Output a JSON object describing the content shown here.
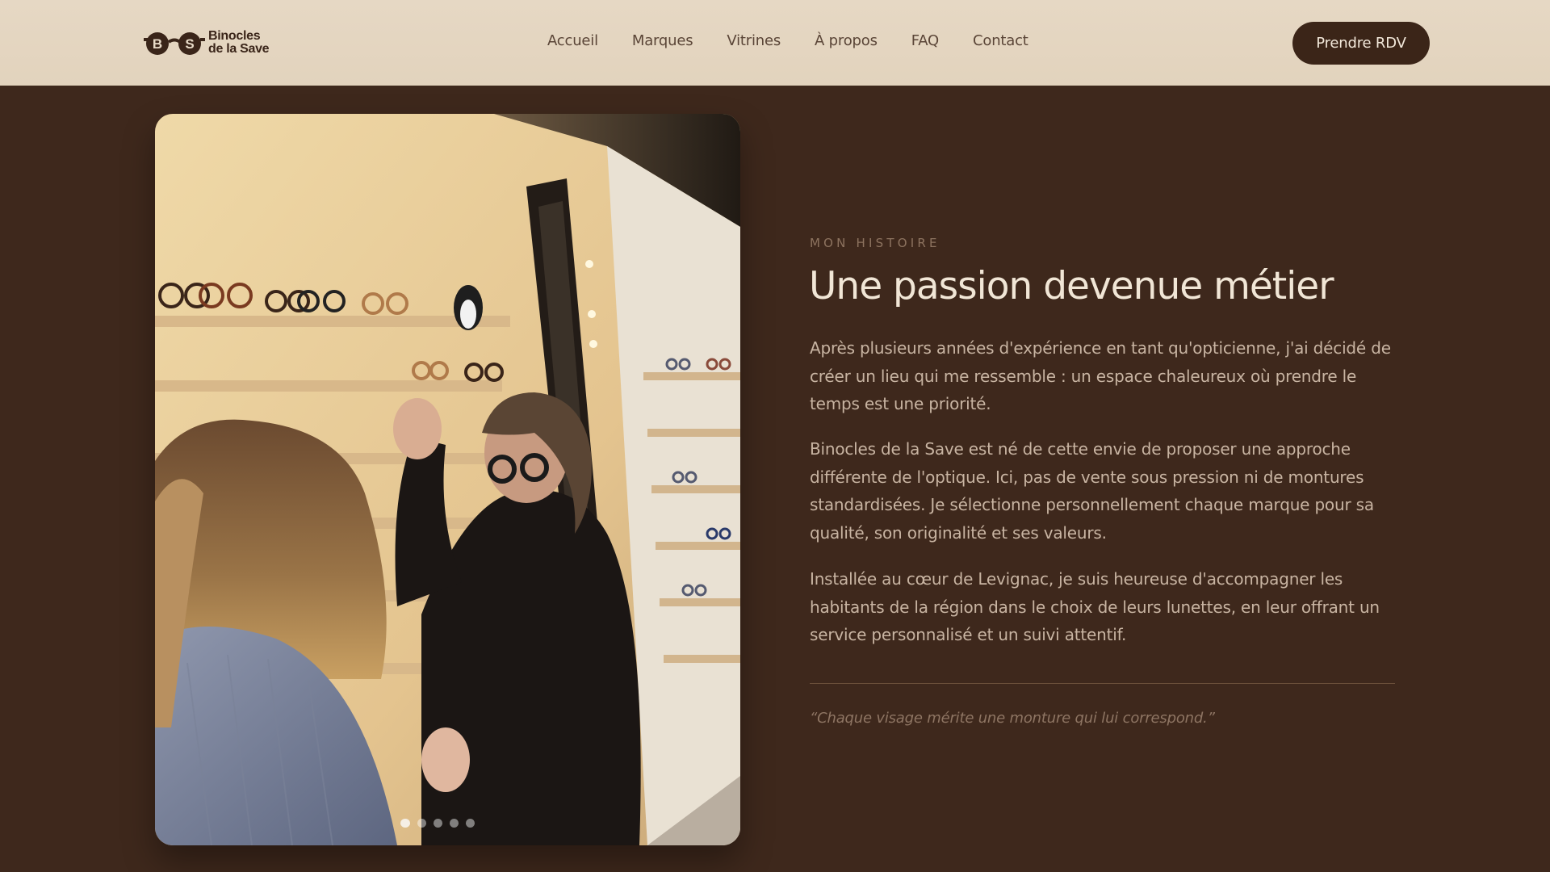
{
  "header": {
    "logo_line1": "Binocles",
    "logo_line2": "de la Save",
    "logo_letters": [
      "B",
      "S"
    ],
    "nav": [
      "Accueil",
      "Marques",
      "Vitrines",
      "À propos",
      "FAQ",
      "Contact"
    ],
    "cta_label": "Prendre RDV"
  },
  "photo": {
    "carousel_dots": 5,
    "active_dot": 0
  },
  "story": {
    "eyebrow": "MON HISTOIRE",
    "title": "Une passion devenue métier",
    "paragraphs": [
      "Après plusieurs années d'expérience en tant qu'opticienne, j'ai décidé de créer un lieu qui me ressemble : un espace chaleureux où prendre le temps est une priorité.",
      "Binocles de la Save est né de cette envie de proposer une approche différente de l'optique. Ici, pas de vente sous pression ni de montures standardisées. Je sélectionne personnellement chaque marque pour sa qualité, son originalité et ses valeurs.",
      "Installée au cœur de Levignac, je suis heureuse d'accompagner les habitants de la région dans le choix de leurs lunettes, en leur offrant un service personnalisé et un suivi attentif."
    ],
    "quote": "“Chaque visage mérite une monture qui lui correspond.”"
  },
  "colors": {
    "background": "#3e281c",
    "header": "#e4d5c0",
    "cta": "#3b2518",
    "title": "#f1e6d6",
    "body_text": "#c8b4a2"
  }
}
